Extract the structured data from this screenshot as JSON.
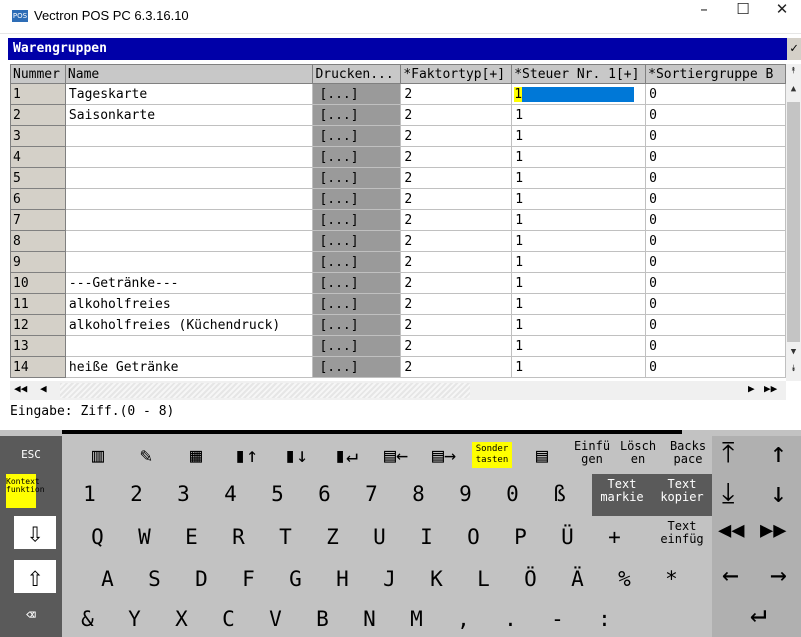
{
  "window": {
    "title": "Vectron POS PC 6.3.16.10",
    "icon_text": "POS",
    "controls": {
      "minimize": "–",
      "maximize": "☐",
      "close": "✕"
    }
  },
  "header": {
    "title": "Warengruppen",
    "check": "✓"
  },
  "table": {
    "columns": [
      "Nummer",
      "Name",
      "Drucken...",
      "*Faktortyp[+]",
      "*Steuer Nr. 1[+]",
      "*Sortiergruppe B"
    ],
    "rows": [
      {
        "num": "1",
        "name": "Tageskarte",
        "druck": "[...]",
        "faktor": "2",
        "steuer": "1",
        "sort": "0"
      },
      {
        "num": "2",
        "name": "Saisonkarte",
        "druck": "[...]",
        "faktor": "2",
        "steuer": "1",
        "sort": "0"
      },
      {
        "num": "3",
        "name": "",
        "druck": "[...]",
        "faktor": "2",
        "steuer": "1",
        "sort": "0"
      },
      {
        "num": "4",
        "name": "",
        "druck": "[...]",
        "faktor": "2",
        "steuer": "1",
        "sort": "0"
      },
      {
        "num": "5",
        "name": "",
        "druck": "[...]",
        "faktor": "2",
        "steuer": "1",
        "sort": "0"
      },
      {
        "num": "6",
        "name": "",
        "druck": "[...]",
        "faktor": "2",
        "steuer": "1",
        "sort": "0"
      },
      {
        "num": "7",
        "name": "",
        "druck": "[...]",
        "faktor": "2",
        "steuer": "1",
        "sort": "0"
      },
      {
        "num": "8",
        "name": "",
        "druck": "[...]",
        "faktor": "2",
        "steuer": "1",
        "sort": "0"
      },
      {
        "num": "9",
        "name": "",
        "druck": "[...]",
        "faktor": "2",
        "steuer": "1",
        "sort": "0"
      },
      {
        "num": "10",
        "name": "---Getränke---",
        "druck": "[...]",
        "faktor": "2",
        "steuer": "1",
        "sort": "0"
      },
      {
        "num": "11",
        "name": "alkoholfreies",
        "druck": "[...]",
        "faktor": "2",
        "steuer": "1",
        "sort": "0"
      },
      {
        "num": "12",
        "name": "alkoholfreies (Küchendruck)",
        "druck": "[...]",
        "faktor": "2",
        "steuer": "1",
        "sort": "0"
      },
      {
        "num": "13",
        "name": "",
        "druck": "[...]",
        "faktor": "2",
        "steuer": "1",
        "sort": "0"
      },
      {
        "num": "14",
        "name": "heiße Getränke",
        "druck": "[...]",
        "faktor": "2",
        "steuer": "1",
        "sort": "0"
      }
    ]
  },
  "status": {
    "eingabe": "Eingabe: Ziff.(0 - 8)"
  },
  "keyboard": {
    "esc": "ESC",
    "kontext": "Kontext funktion",
    "sondertasten": "Sonder tasten",
    "einfuegen": "Einfü gen",
    "loeschen": "Lösch en",
    "backspace": "Backs pace",
    "text_markieren": "Text markie",
    "text_kopieren": "Text kopier",
    "text_einfuegen": "Text einfüg",
    "row1": [
      "1",
      "2",
      "3",
      "4",
      "5",
      "6",
      "7",
      "8",
      "9",
      "0",
      "ß"
    ],
    "row2": [
      "Q",
      "W",
      "E",
      "R",
      "T",
      "Z",
      "U",
      "I",
      "O",
      "P",
      "Ü",
      "+"
    ],
    "row3": [
      "A",
      "S",
      "D",
      "F",
      "G",
      "H",
      "J",
      "K",
      "L",
      "Ö",
      "Ä",
      "%",
      "*"
    ],
    "row4": [
      "&",
      "Y",
      "X",
      "C",
      "V",
      "B",
      "N",
      "M",
      ",",
      ".",
      "-",
      ":"
    ],
    "toolbar_icons": [
      "insert-row-icon",
      "edit-icon",
      "delete-column-icon",
      "move-up-icon",
      "move-down-icon",
      "enter-row-icon",
      "next-column-icon",
      "last-column-icon"
    ]
  },
  "colors": {
    "header_bg": "#0000a8",
    "selection": "#0078d7",
    "highlight": "#ffff00"
  }
}
